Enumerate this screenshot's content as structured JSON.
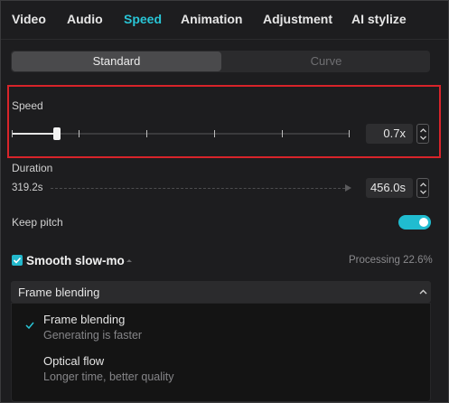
{
  "tabs": [
    {
      "label": "Video"
    },
    {
      "label": "Audio"
    },
    {
      "label": "Speed"
    },
    {
      "label": "Animation"
    },
    {
      "label": "Adjustment"
    },
    {
      "label": "AI stylize"
    }
  ],
  "active_tab": "Speed",
  "segment": {
    "options": [
      "Standard",
      "Curve"
    ],
    "selected": "Standard"
  },
  "speed": {
    "label": "Speed",
    "value": "0.7x"
  },
  "duration": {
    "label": "Duration",
    "original": "319.2s",
    "value": "456.0s"
  },
  "keep_pitch": {
    "label": "Keep pitch",
    "enabled": true
  },
  "smooth_slowmo": {
    "label": "Smooth slow-mo",
    "checked": true,
    "status": "Processing 22.6%"
  },
  "method_dropdown": {
    "selected": "Frame blending",
    "options": [
      {
        "title": "Frame blending",
        "subtitle": "Generating is faster",
        "selected": true
      },
      {
        "title": "Optical flow",
        "subtitle": "Longer time, better quality",
        "selected": false
      }
    ]
  },
  "colors": {
    "accent": "#29c5d6",
    "highlight_border": "#d8242a",
    "background": "#1d1d1f"
  }
}
